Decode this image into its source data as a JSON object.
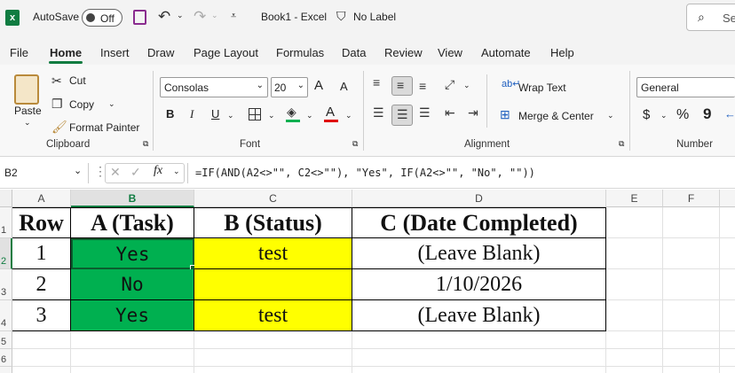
{
  "titlebar": {
    "autosave_label": "AutoSave",
    "autosave_state": "Off",
    "doc_title": "Book1  -  Excel",
    "sensitivity_label": "No Label",
    "search_placeholder": "Se"
  },
  "menu": [
    "File",
    "Home",
    "Insert",
    "Draw",
    "Page Layout",
    "Formulas",
    "Data",
    "Review",
    "View",
    "Automate",
    "Help"
  ],
  "ribbon": {
    "clipboard": {
      "paste": "Paste",
      "cut": "Cut",
      "copy": "Copy",
      "format_painter": "Format Painter",
      "label": "Clipboard"
    },
    "font": {
      "name": "Consolas",
      "size": "20",
      "bold": "B",
      "italic": "I",
      "underline": "U",
      "grow": "A",
      "shrink": "A",
      "font_color_letter": "A",
      "label": "Font"
    },
    "alignment": {
      "wrap_text": "Wrap Text",
      "merge_center": "Merge & Center",
      "label": "Alignment"
    },
    "number": {
      "format": "General",
      "currency": "$",
      "percent": "%",
      "comma": "9",
      "label": "Number"
    }
  },
  "formula_bar": {
    "name_box": "B2",
    "fx": "fx",
    "formula": "=IF(AND(A2<>\"\", C2<>\"\"), \"Yes\", IF(A2<>\"\", \"No\", \"\"))"
  },
  "sheet": {
    "columns": [
      "A",
      "B",
      "C",
      "D",
      "E",
      "F"
    ],
    "rows": [
      "1",
      "2",
      "3",
      "4",
      "5",
      "6"
    ],
    "header": [
      "Row",
      "A (Task)",
      "B (Status)",
      "C (Date Completed)"
    ],
    "data": [
      [
        "1",
        "Yes",
        "test",
        "(Leave Blank)"
      ],
      [
        "2",
        "No",
        "",
        "1/10/2026"
      ],
      [
        "3",
        "Yes",
        "test",
        "(Leave Blank)"
      ]
    ]
  },
  "colors": {
    "green_fill": "#00b050",
    "yellow_fill": "#ffff00",
    "excel_green": "#107c41"
  }
}
